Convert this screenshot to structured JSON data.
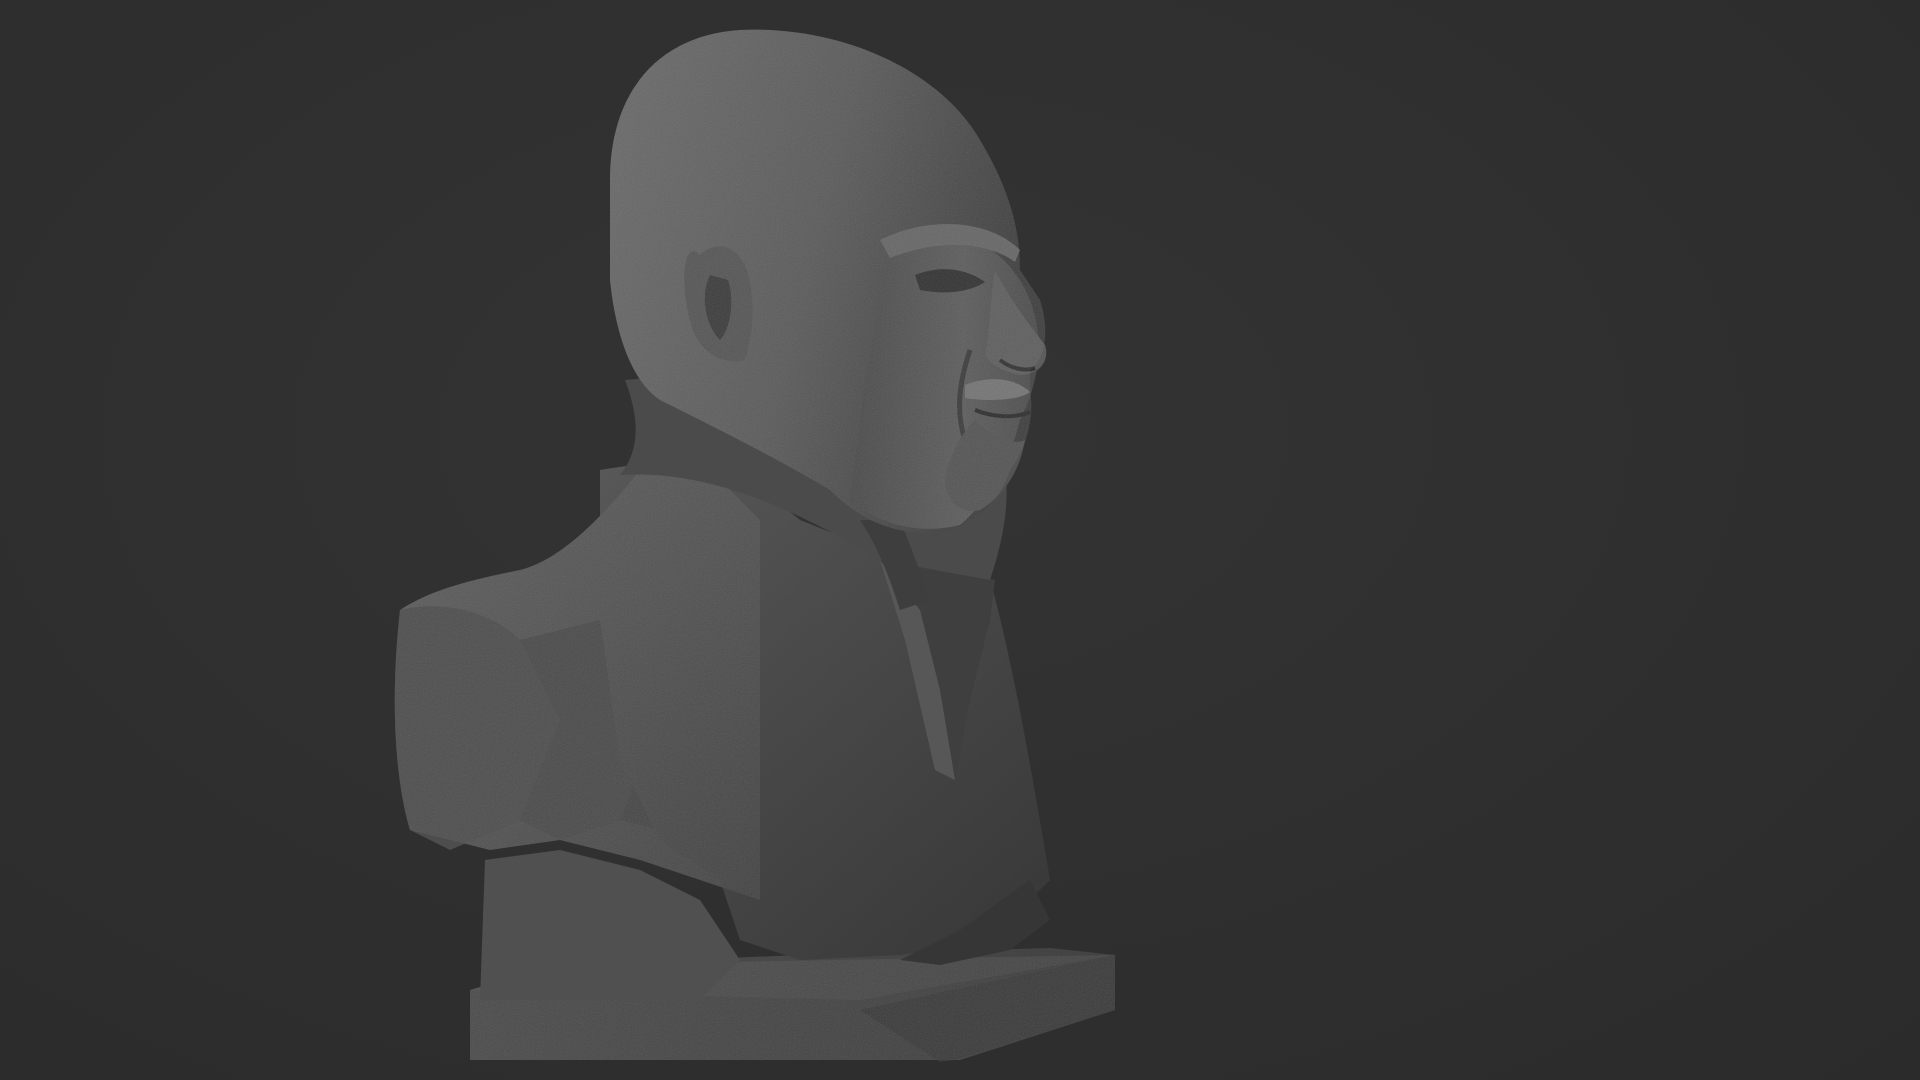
{
  "viewport": {
    "background_color": "#2f2f2f",
    "subject": "sculpted-bust",
    "material_color": "#5a5a5a"
  }
}
